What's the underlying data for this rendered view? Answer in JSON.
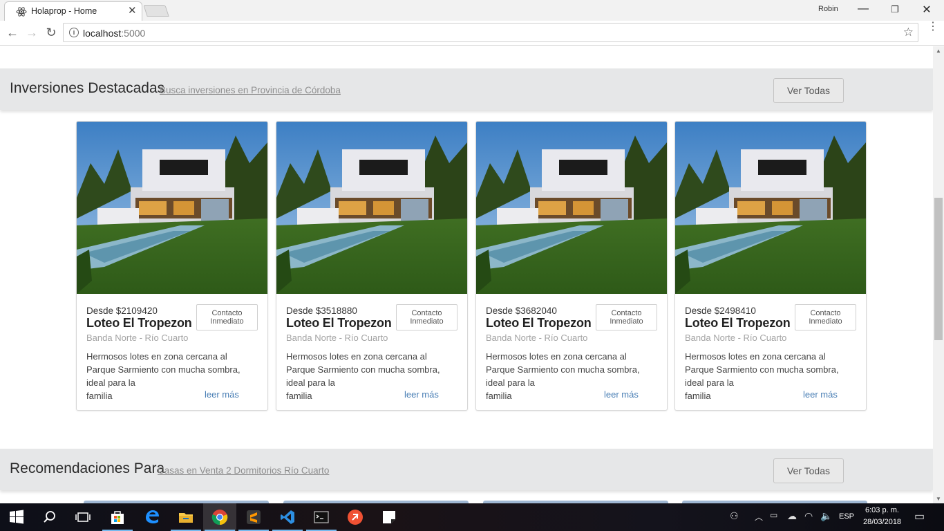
{
  "browser": {
    "tab_title": "Holaprop - Home",
    "tab_close": "✕",
    "profile_name": "Robin",
    "window_min": "—",
    "window_max": "❐",
    "window_close": "✕",
    "url_host": "localhost",
    "url_port": ":5000",
    "back": "←",
    "forward": "→",
    "reload": "↻",
    "star": "☆",
    "info": "i",
    "menu": "⋮"
  },
  "featured": {
    "title": "Inversiones Destacadas",
    "subtitle_link": "Busca inversiones en Provincia de Córdoba",
    "view_all": "Ver Todas",
    "cards": [
      {
        "price": "Desde $2109420",
        "name": "Loteo El Tropezon",
        "location": "Banda Norte - Río Cuarto",
        "description_lines": [
          "Hermosos lotes en zona cercana al",
          "Parque Sarmiento con mucha sombra,",
          "ideal para la",
          "familia"
        ],
        "read_more": "leer más",
        "contact_line1": "Contacto",
        "contact_line2": "Inmediato"
      },
      {
        "price": "Desde $3518880",
        "name": "Loteo El Tropezon",
        "location": "Banda Norte - Río Cuarto",
        "description_lines": [
          "Hermosos lotes en zona cercana al",
          "Parque Sarmiento con mucha sombra,",
          "ideal para la",
          "familia"
        ],
        "read_more": "leer más",
        "contact_line1": "Contacto",
        "contact_line2": "Inmediato"
      },
      {
        "price": "Desde $3682040",
        "name": "Loteo El Tropezon",
        "location": "Banda Norte - Río Cuarto",
        "description_lines": [
          "Hermosos lotes en zona cercana al",
          "Parque Sarmiento con mucha sombra,",
          "ideal para la",
          "familia"
        ],
        "read_more": "leer más",
        "contact_line1": "Contacto",
        "contact_line2": "Inmediato"
      },
      {
        "price": "Desde $2498410",
        "name": "Loteo El Tropezon",
        "location": "Banda Norte - Río Cuarto",
        "description_lines": [
          "Hermosos lotes en zona cercana al",
          "Parque Sarmiento con mucha sombra,",
          "ideal para la",
          "familia"
        ],
        "read_more": "leer más",
        "contact_line1": "Contacto",
        "contact_line2": "Inmediato"
      }
    ]
  },
  "recommendations": {
    "title": "Recomendaciones Para",
    "subtitle_link": "Casas en Venta 2 Dormitorios Río Cuarto",
    "view_all": "Ver Todas"
  },
  "taskbar": {
    "language": "ESP",
    "time": "6:03 p. m.",
    "date": "28/03/2018",
    "apps": [
      "start-icon",
      "search-icon",
      "task-view-icon",
      "store-icon",
      "edge-icon",
      "file-explorer-icon",
      "chrome-icon",
      "sublime-text-icon",
      "vscode-icon",
      "terminal-icon",
      "git-client-icon",
      "sticky-notes-icon"
    ]
  },
  "colors": {
    "section_bar": "#e6e7e8",
    "link_blue": "#4a7fb5",
    "muted_text": "#a3a3a3"
  }
}
